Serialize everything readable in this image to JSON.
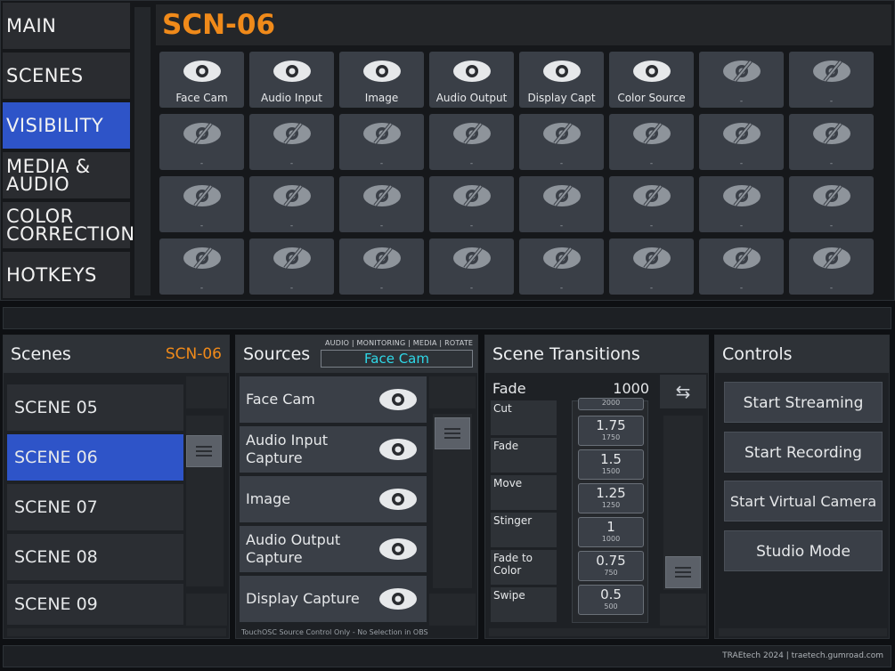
{
  "nav": {
    "items": [
      {
        "label": "MAIN"
      },
      {
        "label": "SCENES"
      },
      {
        "label": "VISIBILITY"
      },
      {
        "label": "MEDIA &\nAUDIO"
      },
      {
        "label": "COLOR\nCORRECTION"
      },
      {
        "label": "HOTKEYS"
      }
    ],
    "active": "VISIBILITY"
  },
  "current_scene": "SCN-06",
  "visibility_grid": [
    {
      "label": "Face Cam",
      "visible": true
    },
    {
      "label": "Audio Input",
      "visible": true
    },
    {
      "label": "Image",
      "visible": true
    },
    {
      "label": "Audio Output",
      "visible": true
    },
    {
      "label": "Display Capt",
      "visible": true
    },
    {
      "label": "Color Source",
      "visible": true
    },
    {
      "label": "-",
      "visible": false
    },
    {
      "label": "-",
      "visible": false
    },
    {
      "label": "-",
      "visible": false
    },
    {
      "label": "-",
      "visible": false
    },
    {
      "label": "-",
      "visible": false
    },
    {
      "label": "-",
      "visible": false
    },
    {
      "label": "-",
      "visible": false
    },
    {
      "label": "-",
      "visible": false
    },
    {
      "label": "-",
      "visible": false
    },
    {
      "label": "-",
      "visible": false
    },
    {
      "label": "-",
      "visible": false
    },
    {
      "label": "-",
      "visible": false
    },
    {
      "label": "-",
      "visible": false
    },
    {
      "label": "-",
      "visible": false
    },
    {
      "label": "-",
      "visible": false
    },
    {
      "label": "-",
      "visible": false
    },
    {
      "label": "-",
      "visible": false
    },
    {
      "label": "-",
      "visible": false
    },
    {
      "label": "-",
      "visible": false
    },
    {
      "label": "-",
      "visible": false
    },
    {
      "label": "-",
      "visible": false
    },
    {
      "label": "-",
      "visible": false
    },
    {
      "label": "-",
      "visible": false
    },
    {
      "label": "-",
      "visible": false
    },
    {
      "label": "-",
      "visible": false
    },
    {
      "label": "-",
      "visible": false
    }
  ],
  "scenes": {
    "title": "Scenes",
    "current": "SCN-06",
    "items": [
      "SCENE 05",
      "SCENE 06",
      "SCENE 07",
      "SCENE 08",
      "SCENE 09"
    ],
    "active": "SCENE 06"
  },
  "sources": {
    "title": "Sources",
    "meta": "AUDIO | MONITORING | MEDIA | ROTATE",
    "selected": "Face Cam",
    "items": [
      {
        "label": "Face Cam",
        "visible": true
      },
      {
        "label": "Audio Input\nCapture",
        "visible": true
      },
      {
        "label": "Image",
        "visible": true
      },
      {
        "label": "Audio Output\nCapture",
        "visible": true
      },
      {
        "label": "Display Capture",
        "visible": true
      }
    ],
    "footer": "TouchOSC Source Control Only - No Selection in OBS"
  },
  "transitions": {
    "title": "Scene Transitions",
    "current_name": "Fade",
    "current_duration": "1000",
    "types": [
      "Cut",
      "Fade",
      "Move",
      "Stinger",
      "Fade to\nColor",
      "Swipe"
    ],
    "durations": [
      {
        "value": "",
        "ms": "2000"
      },
      {
        "value": "1.75",
        "ms": "1750"
      },
      {
        "value": "1.5",
        "ms": "1500"
      },
      {
        "value": "1.25",
        "ms": "1250"
      },
      {
        "value": "1",
        "ms": "1000"
      },
      {
        "value": "0.75",
        "ms": "750"
      },
      {
        "value": "0.5",
        "ms": "500"
      }
    ],
    "repeat_icon": "repeat-icon"
  },
  "controls": {
    "title": "Controls",
    "buttons": [
      "Start Streaming",
      "Start Recording",
      "Start Virtual Camera",
      "Studio Mode"
    ]
  },
  "credit": "TRAEtech 2024 | traetech.gumroad.com",
  "colors": {
    "accent_orange": "#f08a1a",
    "active_blue": "#2e54c8",
    "selected_cyan": "#2fd8e8"
  }
}
